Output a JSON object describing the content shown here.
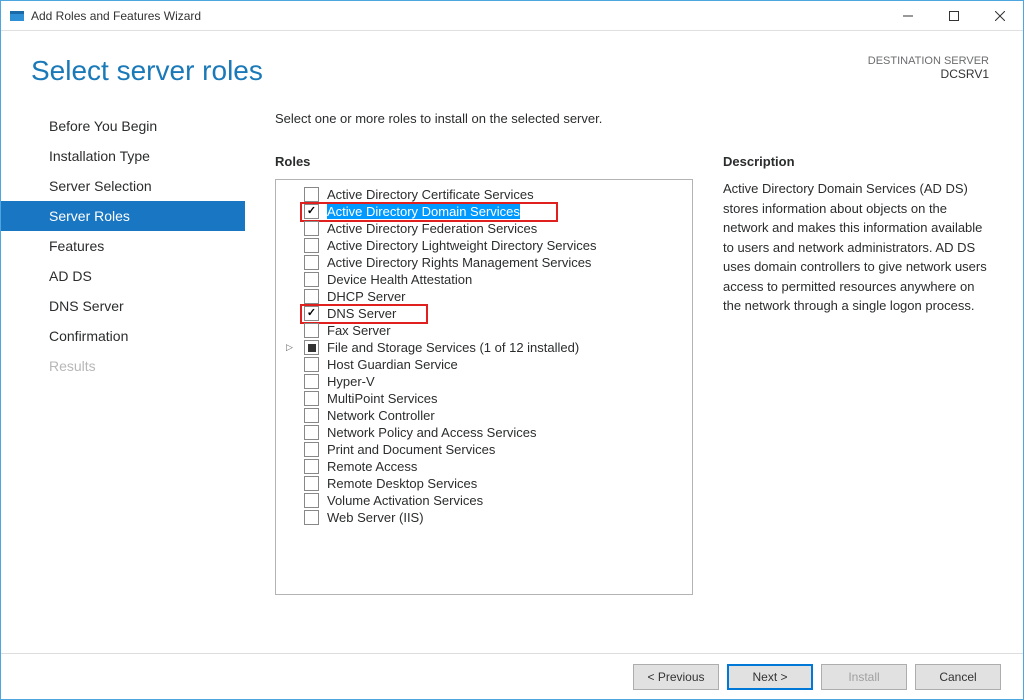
{
  "window": {
    "title": "Add Roles and Features Wizard"
  },
  "header": {
    "title": "Select server roles",
    "destination_label": "DESTINATION SERVER",
    "destination_value": "DCSRV1"
  },
  "sidebar": {
    "items": [
      {
        "label": "Before You Begin",
        "selected": false,
        "disabled": false
      },
      {
        "label": "Installation Type",
        "selected": false,
        "disabled": false
      },
      {
        "label": "Server Selection",
        "selected": false,
        "disabled": false
      },
      {
        "label": "Server Roles",
        "selected": true,
        "disabled": false
      },
      {
        "label": "Features",
        "selected": false,
        "disabled": false
      },
      {
        "label": "AD DS",
        "selected": false,
        "disabled": false
      },
      {
        "label": "DNS Server",
        "selected": false,
        "disabled": false
      },
      {
        "label": "Confirmation",
        "selected": false,
        "disabled": false
      },
      {
        "label": "Results",
        "selected": false,
        "disabled": true
      }
    ]
  },
  "main": {
    "instruction": "Select one or more roles to install on the selected server.",
    "roles_heading": "Roles",
    "description_heading": "Description",
    "description_text": "Active Directory Domain Services (AD DS) stores information about objects on the network and makes this information available to users and network administrators. AD DS uses domain controllers to give network users access to permitted resources anywhere on the network through a single logon process.",
    "roles": [
      {
        "label": "Active Directory Certificate Services",
        "checked": false,
        "highlighted": false
      },
      {
        "label": "Active Directory Domain Services",
        "checked": true,
        "highlighted": true,
        "redbox": true
      },
      {
        "label": "Active Directory Federation Services",
        "checked": false
      },
      {
        "label": "Active Directory Lightweight Directory Services",
        "checked": false
      },
      {
        "label": "Active Directory Rights Management Services",
        "checked": false
      },
      {
        "label": "Device Health Attestation",
        "checked": false
      },
      {
        "label": "DHCP Server",
        "checked": false
      },
      {
        "label": "DNS Server",
        "checked": true,
        "redbox": true
      },
      {
        "label": "Fax Server",
        "checked": false
      },
      {
        "label": "File and Storage Services (1 of 12 installed)",
        "checked": false,
        "indeterminate": true,
        "expander": true
      },
      {
        "label": "Host Guardian Service",
        "checked": false
      },
      {
        "label": "Hyper-V",
        "checked": false
      },
      {
        "label": "MultiPoint Services",
        "checked": false
      },
      {
        "label": "Network Controller",
        "checked": false
      },
      {
        "label": "Network Policy and Access Services",
        "checked": false
      },
      {
        "label": "Print and Document Services",
        "checked": false
      },
      {
        "label": "Remote Access",
        "checked": false
      },
      {
        "label": "Remote Desktop Services",
        "checked": false
      },
      {
        "label": "Volume Activation Services",
        "checked": false
      },
      {
        "label": "Web Server (IIS)",
        "checked": false
      }
    ]
  },
  "footer": {
    "previous": "< Previous",
    "next": "Next >",
    "install": "Install",
    "cancel": "Cancel"
  }
}
